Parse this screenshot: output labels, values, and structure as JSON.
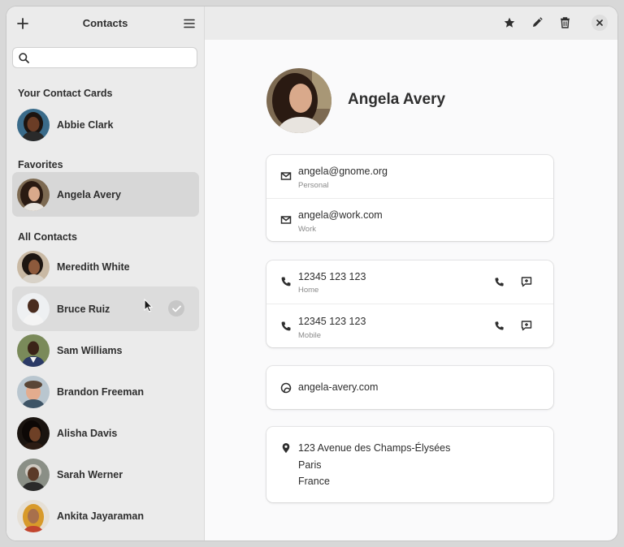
{
  "sidebar": {
    "title": "Contacts",
    "search_placeholder": "",
    "sections": {
      "your_cards": "Your Contact Cards",
      "favorites": "Favorites",
      "all": "All Contacts"
    },
    "your_cards": [
      {
        "name": "Abbie Clark"
      }
    ],
    "favorites": [
      {
        "name": "Angela Avery"
      }
    ],
    "all": [
      {
        "name": "Meredith White"
      },
      {
        "name": "Bruce Ruiz"
      },
      {
        "name": "Sam Williams"
      },
      {
        "name": "Brandon Freeman"
      },
      {
        "name": "Alisha Davis"
      },
      {
        "name": "Sarah Werner"
      },
      {
        "name": "Ankita Jayaraman"
      }
    ]
  },
  "contact": {
    "name": "Angela Avery",
    "emails": [
      {
        "value": "angela@gnome.org",
        "type": "Personal"
      },
      {
        "value": "angela@work.com",
        "type": "Work"
      }
    ],
    "phones": [
      {
        "value": "12345 123 123",
        "type": "Home"
      },
      {
        "value": "12345 123 123",
        "type": "Mobile"
      }
    ],
    "website": "angela-avery.com",
    "address": {
      "line1": "123 Avenue des Champs-Élysées",
      "city": "Paris",
      "country": "France"
    }
  },
  "colors": {
    "sidebar_bg": "#ebebeb",
    "selected_row": "#d7d7d7",
    "content_bg": "#fafafb",
    "card_bg": "#ffffff"
  },
  "icons": [
    "add-icon",
    "menu-icon",
    "search-icon",
    "star-icon",
    "edit-icon",
    "delete-icon",
    "close-icon",
    "mail-icon",
    "phone-icon",
    "message-icon",
    "web-icon",
    "location-icon",
    "check-icon",
    "pointer-cursor-icon"
  ]
}
